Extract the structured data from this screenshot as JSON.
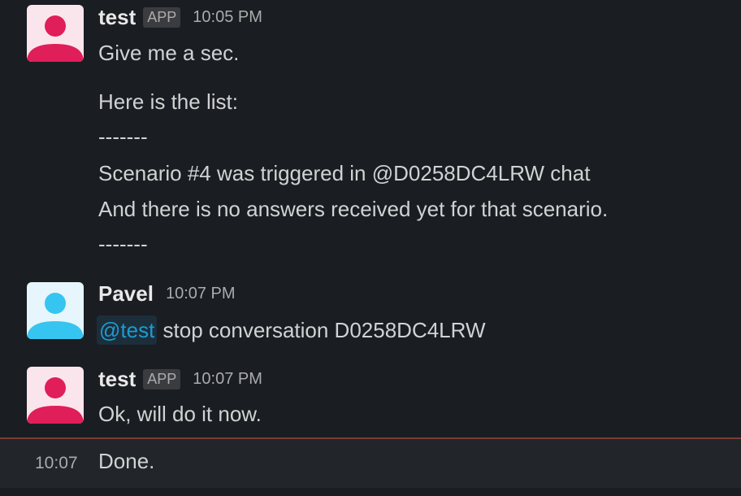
{
  "messages": [
    {
      "sender": "test",
      "badge": "APP",
      "time": "10:05 PM",
      "lines": [
        "Give me a sec.",
        "Here is the list:",
        "-------",
        "Scenario #4 was triggered in @D0258DC4LRW chat",
        "And there is no answers received yet for that scenario.",
        "-------"
      ]
    },
    {
      "sender": "Pavel",
      "time": "10:07 PM",
      "mention": "@test",
      "text": " stop conversation D0258DC4LRW"
    },
    {
      "sender": "test",
      "badge": "APP",
      "time": "10:07 PM",
      "text": "Ok, will do it now."
    },
    {
      "time": "10:07",
      "text": "Done."
    }
  ],
  "colors": {
    "background": "#1a1d21",
    "bot_avatar": "#e01e5a",
    "user_avatar": "#36c5f0",
    "mention": "#1d9bd1",
    "unread_divider": "#7a3b30"
  },
  "icons": {
    "bot_avatar": "default-person-avatar-icon",
    "user_avatar": "default-person-avatar-icon"
  }
}
